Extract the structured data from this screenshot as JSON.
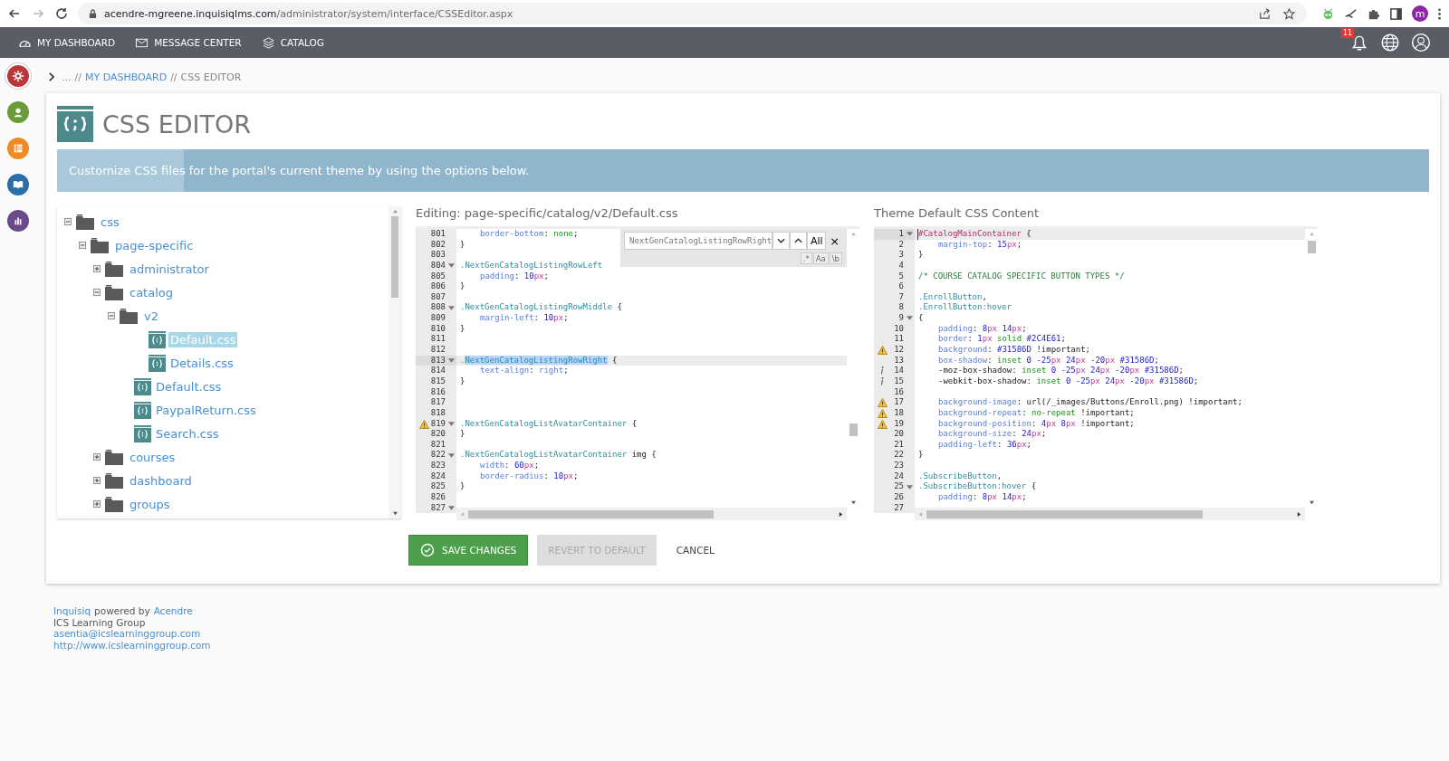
{
  "browser": {
    "forward_disabled": true,
    "url_host": "acendre-mgreene.inquisiqlms.com",
    "url_path": "/administrator/system/interface/CSSEditor.aspx",
    "profile": "m"
  },
  "nav": {
    "items": [
      {
        "label": "MY DASHBOARD",
        "kind": "dashboard"
      },
      {
        "label": "MESSAGE CENTER",
        "kind": "mail"
      },
      {
        "label": "CATALOG",
        "kind": "catalog"
      }
    ],
    "notification_count": "11"
  },
  "rail": [
    {
      "kind": "gear",
      "color": "#b8373a",
      "selected": true
    },
    {
      "kind": "person",
      "color": "#6a9c3a",
      "selected": false
    },
    {
      "kind": "list",
      "color": "#f08a24",
      "selected": false
    },
    {
      "kind": "book",
      "color": "#2a6ea8",
      "selected": false
    },
    {
      "kind": "chart",
      "color": "#6b4a8c",
      "selected": false
    }
  ],
  "breadcrumb": {
    "ellipsis": "...",
    "separator_1": "//",
    "link": "MY DASHBOARD",
    "separator_2": "//",
    "current": "CSS EDITOR"
  },
  "page": {
    "title": "CSS EDITOR",
    "banner": "Customize CSS files for the portal's current theme by using the options below."
  },
  "tree": [
    {
      "label": "css",
      "kind": "folder",
      "expanded": true,
      "children": [
        {
          "label": "page-specific",
          "kind": "folder",
          "expanded": true,
          "children": [
            {
              "label": "administrator",
              "kind": "folder",
              "expanded": false
            },
            {
              "label": "catalog",
              "kind": "folder",
              "expanded": true,
              "children": [
                {
                  "label": "v2",
                  "kind": "folder",
                  "expanded": true,
                  "children": [
                    {
                      "label": "Default.css",
                      "kind": "file",
                      "selected": true
                    },
                    {
                      "label": "Details.css",
                      "kind": "file",
                      "selected": false
                    }
                  ]
                },
                {
                  "label": "Default.css",
                  "kind": "file",
                  "selected": false
                },
                {
                  "label": "PaypalReturn.css",
                  "kind": "file",
                  "selected": false
                },
                {
                  "label": "Search.css",
                  "kind": "file",
                  "selected": false
                }
              ]
            },
            {
              "label": "courses",
              "kind": "folder",
              "expanded": false
            },
            {
              "label": "dashboard",
              "kind": "folder",
              "expanded": false
            },
            {
              "label": "groups",
              "kind": "folder",
              "expanded": false
            }
          ]
        }
      ]
    }
  ],
  "editor": {
    "heading": "Editing: page-specific/catalog/v2/Default.css",
    "search": {
      "value": "NextGenCatalogListingRowRight",
      "all": "All",
      "close": "×",
      "regex": ".*",
      "case": "Aa",
      "word": "\\b"
    },
    "lines": [
      {
        "no": "801",
        "kind": "normal",
        "fold": false,
        "active": false,
        "indented": true,
        "tokens": [
          {
            "text": "border-bottom",
            "kind": "prop"
          },
          {
            "text": ": ",
            "kind": "plain"
          },
          {
            "text": "none",
            "kind": "kw"
          },
          {
            "text": ";",
            "kind": "plain"
          }
        ]
      },
      {
        "no": "802",
        "kind": "normal",
        "fold": false,
        "active": false,
        "indented": false,
        "tokens": [
          {
            "text": "}",
            "kind": "plain"
          }
        ]
      },
      {
        "no": "803",
        "kind": "normal",
        "fold": false,
        "active": false
      },
      {
        "no": "804",
        "kind": "normal",
        "fold": true,
        "active": false,
        "indented": false,
        "tokens": [
          {
            "text": ".NextGenCatalogListingRowLeft",
            "kind": "sel"
          }
        ]
      },
      {
        "no": "805",
        "kind": "normal",
        "fold": false,
        "active": false,
        "indented": true,
        "tokens": [
          {
            "text": "padding",
            "kind": "prop"
          },
          {
            "text": ": ",
            "kind": "plain"
          },
          {
            "text": "10",
            "kind": "num"
          },
          {
            "text": "px",
            "kind": "unit"
          },
          {
            "text": ";",
            "kind": "plain"
          }
        ]
      },
      {
        "no": "806",
        "kind": "normal",
        "fold": false,
        "active": false,
        "indented": false,
        "tokens": [
          {
            "text": "}",
            "kind": "plain"
          }
        ]
      },
      {
        "no": "807",
        "kind": "normal",
        "fold": false,
        "active": false
      },
      {
        "no": "808",
        "kind": "normal",
        "fold": true,
        "active": false,
        "indented": false,
        "tokens": [
          {
            "text": ".NextGenCatalogListingRowMiddle",
            "kind": "sel"
          },
          {
            "text": " {",
            "kind": "plain"
          }
        ]
      },
      {
        "no": "809",
        "kind": "normal",
        "fold": false,
        "active": false,
        "indented": true,
        "tokens": [
          {
            "text": "margin-left",
            "kind": "prop"
          },
          {
            "text": ": ",
            "kind": "plain"
          },
          {
            "text": "10",
            "kind": "num"
          },
          {
            "text": "px",
            "kind": "unit"
          },
          {
            "text": ";",
            "kind": "plain"
          }
        ]
      },
      {
        "no": "810",
        "kind": "normal",
        "fold": false,
        "active": false,
        "indented": false,
        "tokens": [
          {
            "text": "}",
            "kind": "plain"
          }
        ]
      },
      {
        "no": "811",
        "kind": "normal",
        "fold": false,
        "active": false
      },
      {
        "no": "812",
        "kind": "normal",
        "fold": false,
        "active": false
      },
      {
        "no": "813",
        "kind": "normal",
        "fold": true,
        "active": true,
        "indented": false,
        "tokens": [
          {
            "text": ".",
            "kind": "sel"
          },
          {
            "text": "NextGenCatalogListingRowRight",
            "kind": "match"
          },
          {
            "text": " {",
            "kind": "plain"
          }
        ]
      },
      {
        "no": "814",
        "kind": "normal",
        "fold": false,
        "active": false,
        "indented": true,
        "tokens": [
          {
            "text": "text-align",
            "kind": "prop"
          },
          {
            "text": ": ",
            "kind": "plain"
          },
          {
            "text": "right",
            "kind": "prop"
          },
          {
            "text": ";",
            "kind": "plain"
          }
        ]
      },
      {
        "no": "815",
        "kind": "normal",
        "fold": false,
        "active": false,
        "indented": false,
        "tokens": [
          {
            "text": "}",
            "kind": "plain"
          }
        ]
      },
      {
        "no": "816",
        "kind": "normal",
        "fold": false,
        "active": false
      },
      {
        "no": "817",
        "kind": "normal",
        "fold": false,
        "active": false
      },
      {
        "no": "818",
        "kind": "normal",
        "fold": false,
        "active": false
      },
      {
        "no": "819",
        "kind": "warning",
        "fold": true,
        "active": false,
        "indented": false,
        "tokens": [
          {
            "text": ".NextGenCatalogListAvatarContainer",
            "kind": "sel"
          },
          {
            "text": " {",
            "kind": "plain"
          }
        ]
      },
      {
        "no": "820",
        "kind": "normal",
        "fold": false,
        "active": false,
        "indented": false,
        "tokens": [
          {
            "text": "}",
            "kind": "plain"
          }
        ]
      },
      {
        "no": "821",
        "kind": "normal",
        "fold": false,
        "active": false
      },
      {
        "no": "822",
        "kind": "normal",
        "fold": true,
        "active": false,
        "indented": false,
        "tokens": [
          {
            "text": ".NextGenCatalogListAvatarContainer",
            "kind": "sel"
          },
          {
            "text": " img {",
            "kind": "plain"
          }
        ]
      },
      {
        "no": "823",
        "kind": "normal",
        "fold": false,
        "active": false,
        "indented": true,
        "tokens": [
          {
            "text": "width",
            "kind": "prop"
          },
          {
            "text": ": ",
            "kind": "plain"
          },
          {
            "text": "60",
            "kind": "num"
          },
          {
            "text": "px",
            "kind": "unit"
          },
          {
            "text": ";",
            "kind": "plain"
          }
        ]
      },
      {
        "no": "824",
        "kind": "normal",
        "fold": false,
        "active": false,
        "indented": true,
        "tokens": [
          {
            "text": "border-radius",
            "kind": "prop"
          },
          {
            "text": ": ",
            "kind": "plain"
          },
          {
            "text": "10",
            "kind": "num"
          },
          {
            "text": "px",
            "kind": "unit"
          },
          {
            "text": ";",
            "kind": "plain"
          }
        ]
      },
      {
        "no": "825",
        "kind": "normal",
        "fold": false,
        "active": false,
        "indented": false,
        "tokens": [
          {
            "text": "}",
            "kind": "plain"
          }
        ]
      },
      {
        "no": "826",
        "kind": "normal",
        "fold": false,
        "active": false
      },
      {
        "no": "827",
        "kind": "normal",
        "fold": true,
        "active": false
      }
    ]
  },
  "theme": {
    "heading": "Theme Default CSS Content",
    "lines": [
      {
        "no": "1",
        "kind": "normal",
        "fold": true,
        "active": true,
        "indented": false,
        "tokens": [
          {
            "text": "#CatalogMainContainer",
            "kind": "id"
          },
          {
            "text": " {",
            "kind": "plain"
          }
        ]
      },
      {
        "no": "2",
        "kind": "normal",
        "fold": false,
        "active": false,
        "indented": true,
        "tokens": [
          {
            "text": "margin-top",
            "kind": "prop"
          },
          {
            "text": ": ",
            "kind": "plain"
          },
          {
            "text": "15",
            "kind": "num"
          },
          {
            "text": "px",
            "kind": "unit"
          },
          {
            "text": ";",
            "kind": "plain"
          }
        ]
      },
      {
        "no": "3",
        "kind": "normal",
        "fold": false,
        "active": false,
        "indented": false,
        "tokens": [
          {
            "text": "}",
            "kind": "plain"
          }
        ]
      },
      {
        "no": "4",
        "kind": "normal",
        "fold": false,
        "active": false
      },
      {
        "no": "5",
        "kind": "normal",
        "fold": false,
        "active": false,
        "indented": false,
        "tokens": [
          {
            "text": "/* COURSE CATALOG SPECIFIC BUTTON TYPES */",
            "kind": "comment"
          }
        ]
      },
      {
        "no": "6",
        "kind": "normal",
        "fold": false,
        "active": false
      },
      {
        "no": "7",
        "kind": "normal",
        "fold": false,
        "active": false,
        "indented": false,
        "tokens": [
          {
            "text": ".EnrollButton",
            "kind": "sel"
          },
          {
            "text": ",",
            "kind": "plain"
          }
        ]
      },
      {
        "no": "8",
        "kind": "normal",
        "fold": false,
        "active": false,
        "indented": false,
        "tokens": [
          {
            "text": ".EnrollButton:hover",
            "kind": "sel"
          }
        ]
      },
      {
        "no": "9",
        "kind": "normal",
        "fold": true,
        "active": false,
        "indented": false,
        "tokens": [
          {
            "text": "{",
            "kind": "plain"
          }
        ]
      },
      {
        "no": "10",
        "kind": "normal",
        "fold": false,
        "active": false,
        "indented": true,
        "tokens": [
          {
            "text": "padding",
            "kind": "prop"
          },
          {
            "text": ": ",
            "kind": "plain"
          },
          {
            "text": "8",
            "kind": "num"
          },
          {
            "text": "px ",
            "kind": "unit"
          },
          {
            "text": "14",
            "kind": "num"
          },
          {
            "text": "px",
            "kind": "unit"
          },
          {
            "text": ";",
            "kind": "plain"
          }
        ]
      },
      {
        "no": "11",
        "kind": "normal",
        "fold": false,
        "active": false,
        "indented": true,
        "tokens": [
          {
            "text": "border",
            "kind": "prop"
          },
          {
            "text": ": ",
            "kind": "plain"
          },
          {
            "text": "1",
            "kind": "num"
          },
          {
            "text": "px ",
            "kind": "unit"
          },
          {
            "text": "solid",
            "kind": "kw"
          },
          {
            "text": " #2C4E61",
            "kind": "num"
          },
          {
            "text": ";",
            "kind": "plain"
          }
        ]
      },
      {
        "no": "12",
        "kind": "warning",
        "fold": false,
        "active": false,
        "indented": true,
        "tokens": [
          {
            "text": "background",
            "kind": "prop"
          },
          {
            "text": ": ",
            "kind": "plain"
          },
          {
            "text": "#31586D",
            "kind": "num"
          },
          {
            "text": " !important;",
            "kind": "plain"
          }
        ]
      },
      {
        "no": "13",
        "kind": "normal",
        "fold": false,
        "active": false,
        "indented": true,
        "tokens": [
          {
            "text": "box-shadow",
            "kind": "prop"
          },
          {
            "text": ": ",
            "kind": "plain"
          },
          {
            "text": "inset",
            "kind": "kw"
          },
          {
            "text": " 0 -25",
            "kind": "num"
          },
          {
            "text": "px ",
            "kind": "unit"
          },
          {
            "text": "24",
            "kind": "num"
          },
          {
            "text": "px ",
            "kind": "unit"
          },
          {
            "text": "-20",
            "kind": "num"
          },
          {
            "text": "px ",
            "kind": "unit"
          },
          {
            "text": "#31586D",
            "kind": "num"
          },
          {
            "text": ";",
            "kind": "plain"
          }
        ]
      },
      {
        "no": "14",
        "kind": "info",
        "fold": false,
        "active": false,
        "indented": true,
        "tokens": [
          {
            "text": "-moz-box-shadow: ",
            "kind": "plain"
          },
          {
            "text": "inset",
            "kind": "kw"
          },
          {
            "text": " 0 -25",
            "kind": "num"
          },
          {
            "text": "px ",
            "kind": "unit"
          },
          {
            "text": "24",
            "kind": "num"
          },
          {
            "text": "px ",
            "kind": "unit"
          },
          {
            "text": "-20",
            "kind": "num"
          },
          {
            "text": "px ",
            "kind": "unit"
          },
          {
            "text": "#31586D",
            "kind": "num"
          },
          {
            "text": ";",
            "kind": "plain"
          }
        ]
      },
      {
        "no": "15",
        "kind": "info",
        "fold": false,
        "active": false,
        "indented": true,
        "tokens": [
          {
            "text": "-webkit-box-shadow: ",
            "kind": "plain"
          },
          {
            "text": "inset",
            "kind": "kw"
          },
          {
            "text": " 0 -25",
            "kind": "num"
          },
          {
            "text": "px ",
            "kind": "unit"
          },
          {
            "text": "24",
            "kind": "num"
          },
          {
            "text": "px ",
            "kind": "unit"
          },
          {
            "text": "-20",
            "kind": "num"
          },
          {
            "text": "px ",
            "kind": "unit"
          },
          {
            "text": "#31586D",
            "kind": "num"
          },
          {
            "text": ";",
            "kind": "plain"
          }
        ]
      },
      {
        "no": "16",
        "kind": "normal",
        "fold": false,
        "active": false
      },
      {
        "no": "17",
        "kind": "warning",
        "fold": false,
        "active": false,
        "indented": true,
        "tokens": [
          {
            "text": "background-image",
            "kind": "prop"
          },
          {
            "text": ": ",
            "kind": "plain"
          },
          {
            "text": "url(/_images/Buttons/Enroll.png)",
            "kind": "plain"
          },
          {
            "text": " !important;",
            "kind": "plain"
          }
        ]
      },
      {
        "no": "18",
        "kind": "warning",
        "fold": false,
        "active": false,
        "indented": true,
        "tokens": [
          {
            "text": "background-repeat",
            "kind": "prop"
          },
          {
            "text": ": ",
            "kind": "plain"
          },
          {
            "text": "no-repeat",
            "kind": "kw"
          },
          {
            "text": " !important;",
            "kind": "plain"
          }
        ]
      },
      {
        "no": "19",
        "kind": "warning",
        "fold": false,
        "active": false,
        "indented": true,
        "tokens": [
          {
            "text": "background-position",
            "kind": "prop"
          },
          {
            "text": ": ",
            "kind": "plain"
          },
          {
            "text": "4",
            "kind": "num"
          },
          {
            "text": "px ",
            "kind": "unit"
          },
          {
            "text": "8",
            "kind": "num"
          },
          {
            "text": "px",
            "kind": "unit"
          },
          {
            "text": " !important;",
            "kind": "plain"
          }
        ]
      },
      {
        "no": "20",
        "kind": "normal",
        "fold": false,
        "active": false,
        "indented": true,
        "tokens": [
          {
            "text": "background-size",
            "kind": "prop"
          },
          {
            "text": ": ",
            "kind": "plain"
          },
          {
            "text": "24",
            "kind": "num"
          },
          {
            "text": "px",
            "kind": "unit"
          },
          {
            "text": ";",
            "kind": "plain"
          }
        ]
      },
      {
        "no": "21",
        "kind": "normal",
        "fold": false,
        "active": false,
        "indented": true,
        "tokens": [
          {
            "text": "padding-left",
            "kind": "prop"
          },
          {
            "text": ": ",
            "kind": "plain"
          },
          {
            "text": "36",
            "kind": "num"
          },
          {
            "text": "px",
            "kind": "unit"
          },
          {
            "text": ";",
            "kind": "plain"
          }
        ]
      },
      {
        "no": "22",
        "kind": "normal",
        "fold": false,
        "active": false,
        "indented": false,
        "tokens": [
          {
            "text": "}",
            "kind": "plain"
          }
        ]
      },
      {
        "no": "23",
        "kind": "normal",
        "fold": false,
        "active": false
      },
      {
        "no": "24",
        "kind": "normal",
        "fold": false,
        "active": false,
        "indented": false,
        "tokens": [
          {
            "text": ".SubscribeButton",
            "kind": "sel"
          },
          {
            "text": ",",
            "kind": "plain"
          }
        ]
      },
      {
        "no": "25",
        "kind": "normal",
        "fold": true,
        "active": false,
        "indented": false,
        "tokens": [
          {
            "text": ".SubscribeButton:hover",
            "kind": "sel"
          },
          {
            "text": " {",
            "kind": "plain"
          }
        ]
      },
      {
        "no": "26",
        "kind": "normal",
        "fold": false,
        "active": false,
        "indented": true,
        "tokens": [
          {
            "text": "padding",
            "kind": "prop"
          },
          {
            "text": ": ",
            "kind": "plain"
          },
          {
            "text": "8",
            "kind": "num"
          },
          {
            "text": "px ",
            "kind": "unit"
          },
          {
            "text": "14",
            "kind": "num"
          },
          {
            "text": "px",
            "kind": "unit"
          },
          {
            "text": ";",
            "kind": "plain"
          }
        ]
      },
      {
        "no": "27",
        "kind": "normal",
        "fold": false,
        "active": false
      }
    ]
  },
  "actions": [
    {
      "label": "SAVE CHANGES",
      "kind": "primary",
      "disabled": false
    },
    {
      "label": "REVERT TO DEFAULT",
      "kind": "secondary",
      "disabled": true
    },
    {
      "label": "CANCEL",
      "kind": "link",
      "disabled": false
    }
  ],
  "footer": {
    "line_1": [
      {
        "text": "Inquisiq",
        "link": true
      },
      {
        "text": "powered by",
        "link": false
      },
      {
        "text": "Acendre",
        "link": true
      }
    ],
    "company": "ICS Learning Group",
    "email": "asentia@icslearninggroup.com",
    "website": "http://www.icslearninggroup.com"
  }
}
